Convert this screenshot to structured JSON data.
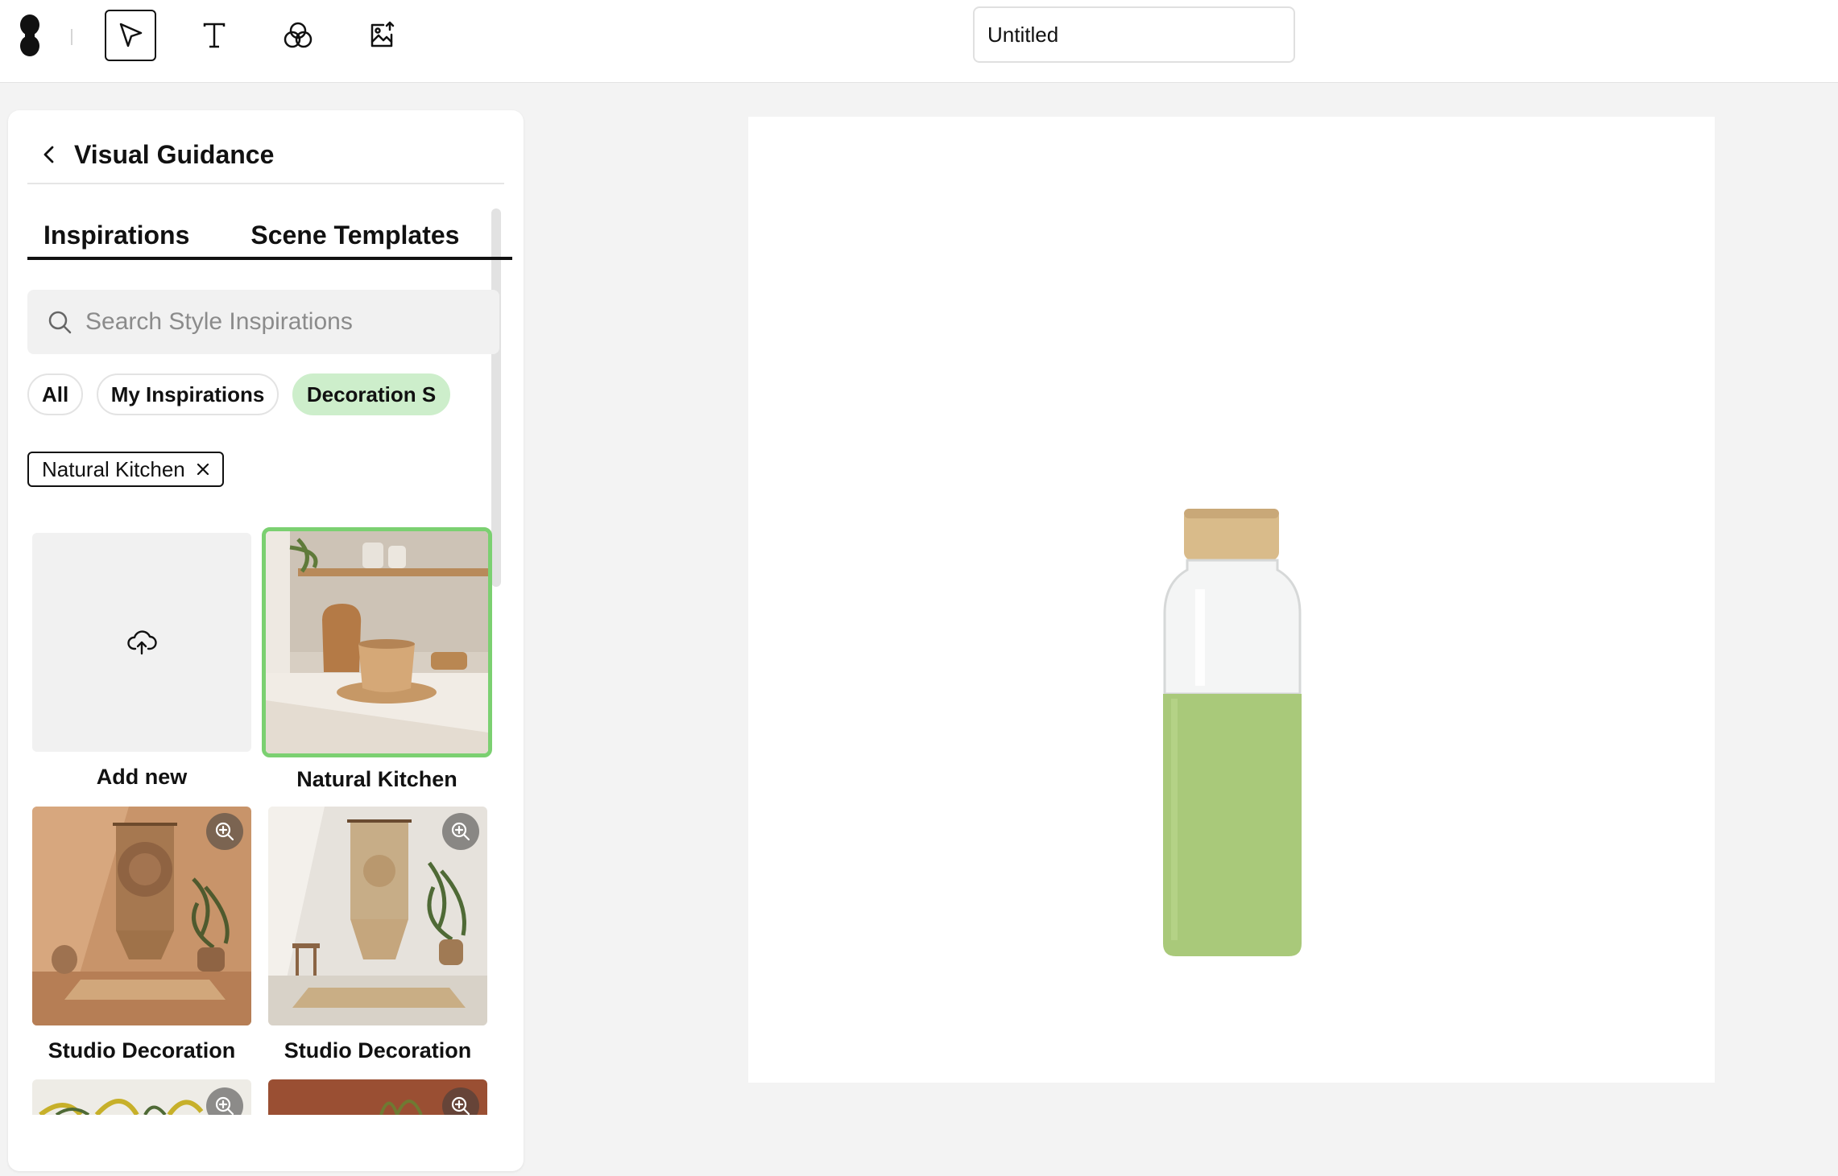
{
  "toolbar": {
    "logo_icon": "app-logo",
    "tools": [
      {
        "name": "select-tool",
        "icon": "cursor-arrow-icon",
        "active": true
      },
      {
        "name": "text-tool",
        "icon": "text-T-icon",
        "active": false
      },
      {
        "name": "blend-tool",
        "icon": "overlapping-circles-icon",
        "active": false
      },
      {
        "name": "image-upload-tool",
        "icon": "image-upload-icon",
        "active": false
      }
    ],
    "document_title": "Untitled"
  },
  "panel": {
    "title": "Visual Guidance",
    "tabs": [
      {
        "label": "Inspirations",
        "active": true
      },
      {
        "label": "Scene Templates",
        "active": false
      }
    ],
    "search_placeholder": "Search Style Inspirations",
    "chips": [
      {
        "label": "All",
        "selected": false
      },
      {
        "label": "My Inspirations",
        "selected": false
      },
      {
        "label": "Decoration S",
        "selected": true
      }
    ],
    "active_filter": "Natural Kitchen",
    "cards": [
      {
        "label": "Add new",
        "type": "add"
      },
      {
        "label": "Natural Kitchen",
        "type": "image",
        "selected": true
      },
      {
        "label": "Studio Decoration",
        "type": "image"
      },
      {
        "label": "Studio Decoration",
        "type": "image"
      }
    ]
  },
  "colors": {
    "accent_green": "#7bd071",
    "chip_selected": "#cdeecb",
    "bottle_sleeve": "#a9c97a",
    "bottle_cap": "#d9bb8a"
  }
}
